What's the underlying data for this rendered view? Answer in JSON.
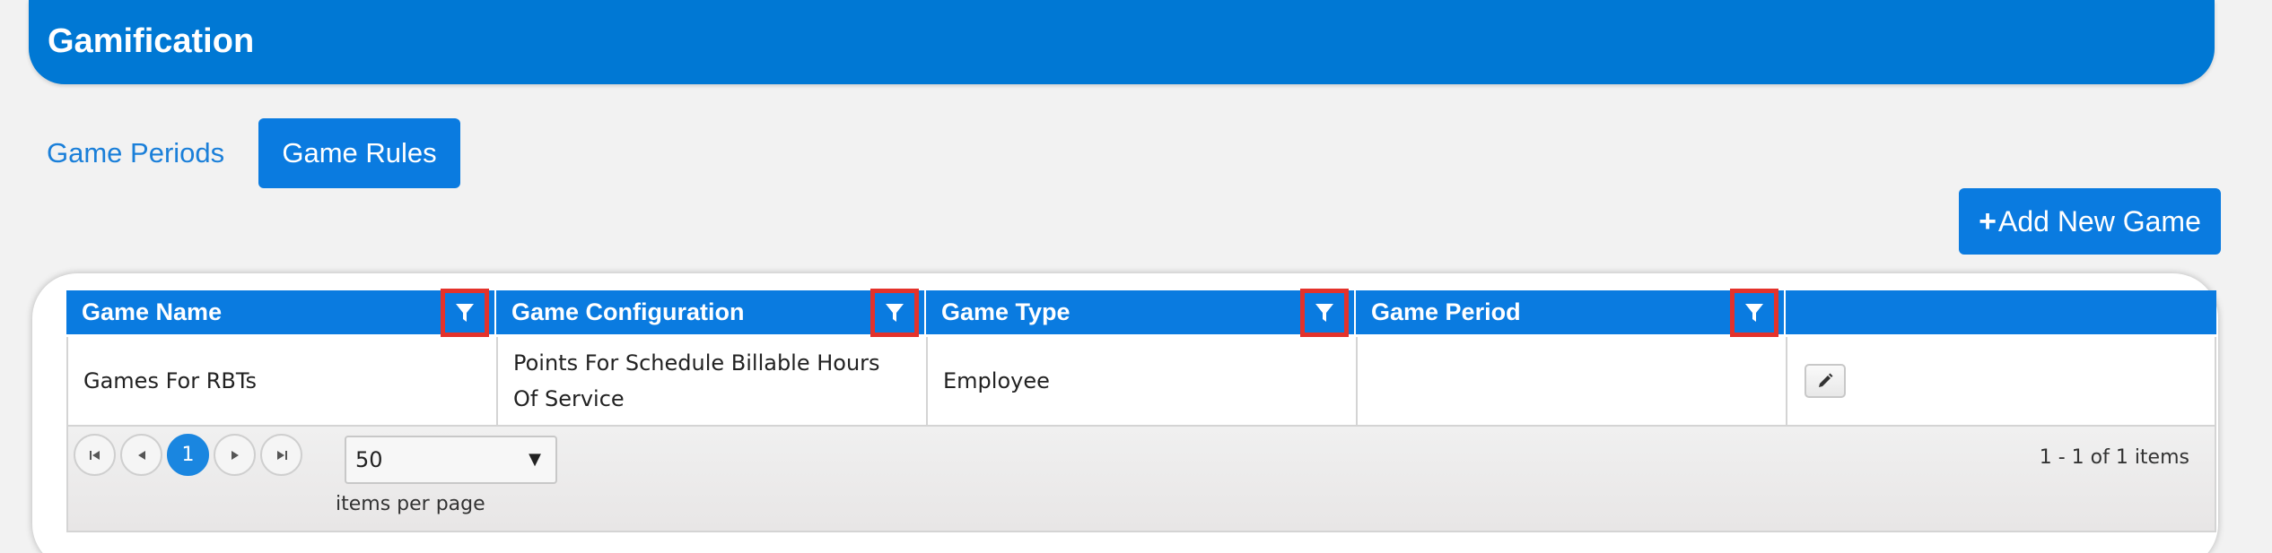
{
  "header": {
    "title": "Gamification"
  },
  "tabs": [
    {
      "label": "Game Periods",
      "active": false
    },
    {
      "label": "Game Rules",
      "active": true
    }
  ],
  "toolbar": {
    "add_label": "Add New Game",
    "add_icon": "+"
  },
  "grid": {
    "columns": [
      "Game Name",
      "Game Configuration",
      "Game Type",
      "Game Period",
      ""
    ],
    "rows": [
      {
        "name": "Games For RBTs",
        "configuration": "Points For Schedule Billable Hours Of Service",
        "type": "Employee",
        "period": ""
      }
    ]
  },
  "pager": {
    "current_page": "1",
    "page_size": "50",
    "items_per_page_label": "items per page",
    "info": "1 - 1 of 1 items"
  },
  "colors": {
    "primary": "#0a7be0",
    "header": "#0078d4",
    "filter_highlight": "#e4322b"
  }
}
